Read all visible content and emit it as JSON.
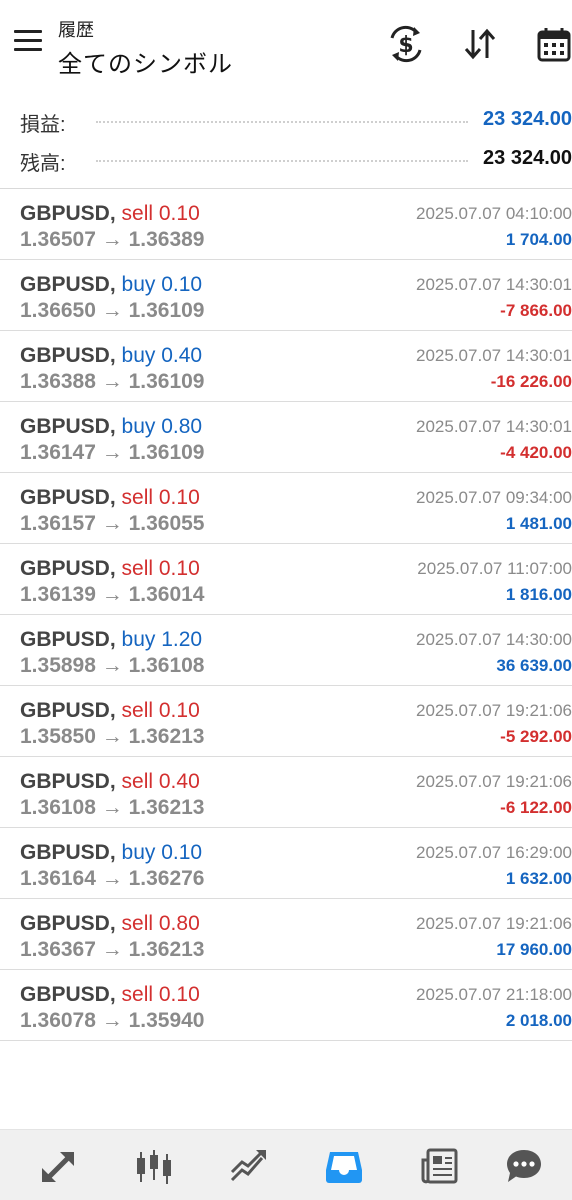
{
  "header": {
    "subtitle": "履歴",
    "title": "全てのシンボル",
    "icons": [
      "menu-icon",
      "currency-exchange-icon",
      "sort-icon",
      "calendar-icon"
    ]
  },
  "summary": {
    "profit_label": "損益:",
    "profit_value": "23 324.00",
    "balance_label": "残高:",
    "balance_value": "23 324.00"
  },
  "colors": {
    "buy": "#1565c0",
    "sell": "#d32f2f",
    "positive": "#1565c0",
    "negative": "#d32f2f",
    "active_tab": "#2196f3"
  },
  "trades": [
    {
      "symbol": "GBPUSD,",
      "side": "sell 0.10",
      "prices": "1.36507 → 1.36389",
      "time": "2025.07.07 04:10:00",
      "profit": "1 704.00"
    },
    {
      "symbol": "GBPUSD,",
      "side": "buy 0.10",
      "prices": "1.36650 → 1.36109",
      "time": "2025.07.07 14:30:01",
      "profit": "-7 866.00"
    },
    {
      "symbol": "GBPUSD,",
      "side": "buy 0.40",
      "prices": "1.36388 → 1.36109",
      "time": "2025.07.07 14:30:01",
      "profit": "-16 226.00"
    },
    {
      "symbol": "GBPUSD,",
      "side": "buy 0.80",
      "prices": "1.36147 → 1.36109",
      "time": "2025.07.07 14:30:01",
      "profit": "-4 420.00"
    },
    {
      "symbol": "GBPUSD,",
      "side": "sell 0.10",
      "prices": "1.36157 → 1.36055",
      "time": "2025.07.07 09:34:00",
      "profit": "1 481.00"
    },
    {
      "symbol": "GBPUSD,",
      "side": "sell 0.10",
      "prices": "1.36139 → 1.36014",
      "time": "2025.07.07 11:07:00",
      "profit": "1 816.00"
    },
    {
      "symbol": "GBPUSD,",
      "side": "buy 1.20",
      "prices": "1.35898 → 1.36108",
      "time": "2025.07.07 14:30:00",
      "profit": "36 639.00"
    },
    {
      "symbol": "GBPUSD,",
      "side": "sell 0.10",
      "prices": "1.35850 → 1.36213",
      "time": "2025.07.07 19:21:06",
      "profit": "-5 292.00"
    },
    {
      "symbol": "GBPUSD,",
      "side": "sell 0.40",
      "prices": "1.36108 → 1.36213",
      "time": "2025.07.07 19:21:06",
      "profit": "-6 122.00"
    },
    {
      "symbol": "GBPUSD,",
      "side": "buy 0.10",
      "prices": "1.36164 → 1.36276",
      "time": "2025.07.07 16:29:00",
      "profit": "1 632.00"
    },
    {
      "symbol": "GBPUSD,",
      "side": "sell 0.80",
      "prices": "1.36367 → 1.36213",
      "time": "2025.07.07 19:21:06",
      "profit": "17 960.00"
    },
    {
      "symbol": "GBPUSD,",
      "side": "sell 0.10",
      "prices": "1.36078 → 1.35940",
      "time": "2025.07.07 21:18:00",
      "profit": "2 018.00"
    }
  ],
  "nav": {
    "items": [
      "quotes-icon",
      "chart-icon",
      "trade-icon",
      "history-icon",
      "news-icon",
      "chat-icon"
    ],
    "active": "history-icon"
  }
}
